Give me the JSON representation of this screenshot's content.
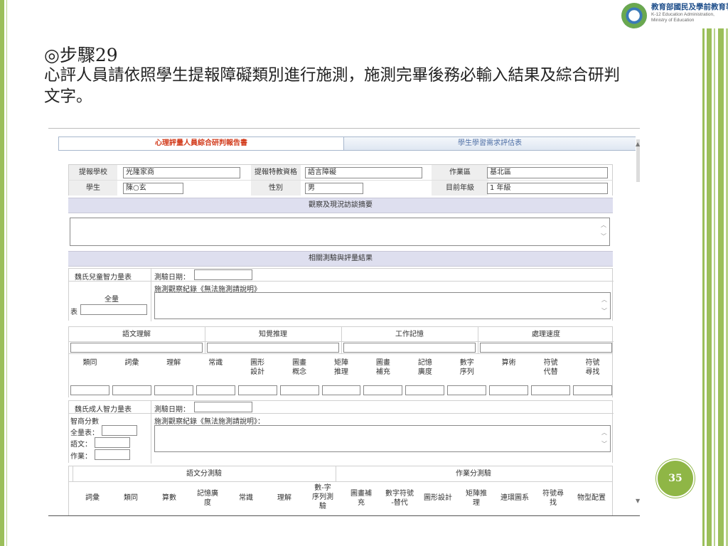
{
  "slide": {
    "step_title": "◎步驟29",
    "description": "心評人員請依照學生提報障礙類別進行施測，施測完畢後務必輸入結果及綜合研判文字。",
    "page_number": "35",
    "logo_main": "教育部國民及學前教育署",
    "logo_sub1": "K-12 Education Administration,",
    "logo_sub2": "Ministry of Education"
  },
  "tabs": {
    "active": "心理評量人員綜合研判報告書",
    "inactive": "學生學習需求評估表"
  },
  "form": {
    "school_label": "提報學校",
    "school_value": "光隆家商",
    "category_label": "提報特教資格",
    "category_value": "語言障礙",
    "district_label": "作業區",
    "district_value": "基北區",
    "student_label": "學生",
    "student_value": "陳○玄",
    "gender_label": "性別",
    "gender_value": "男",
    "grade_label": "目前年級",
    "grade_value": "1 年級",
    "observation_section": "觀察及現況訪談摘要",
    "results_section": "相關測驗與評量結果"
  },
  "wisc": {
    "name": "魏氏兒童智力量表",
    "date_label": "測驗日期：",
    "full_scale_top": "全量",
    "full_scale_bottom": "表",
    "notes_label": "施測觀察紀錄《無法施測請說明》",
    "index_headers": [
      "語文理解",
      "知覺推理",
      "工作記憶",
      "處理速度"
    ],
    "subtests": [
      "類同",
      "詞彙",
      "理解",
      "常識",
      "圖形\n設計",
      "圖畫\n概念",
      "矩陣\n推理",
      "圖畫\n補充",
      "記憶\n廣度",
      "數字\n序列",
      "算術",
      "符號\n代替",
      "符號\n尋找"
    ]
  },
  "wais": {
    "name": "魏氏成人智力量表",
    "date_label": "測驗日期：",
    "iq_label": "智商分數",
    "full_label": "全量表：",
    "verbal_label": "語文：",
    "perf_label": "作業：",
    "notes_label": "施測觀察紀錄《無法施測請說明》：",
    "verbal_group": "語文分測驗",
    "perf_group": "作業分測驗",
    "subtests": [
      "詞彙",
      "類同",
      "算數",
      "記憶廣\n度",
      "常識",
      "理解",
      "數-字\n序列測\n驗",
      "圖畫補\n充",
      "數字符號\n-替代",
      "圖形設計",
      "矩陣推\n理",
      "連環圖系",
      "符號尋\n找",
      "物型配置"
    ]
  }
}
